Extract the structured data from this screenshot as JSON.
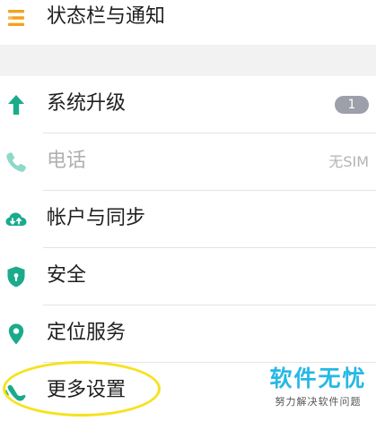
{
  "top_item": {
    "label": "状态栏与通知",
    "icon": "menu-lines-icon"
  },
  "items": [
    {
      "label": "系统升级",
      "icon": "arrow-up-icon",
      "badge": "1"
    },
    {
      "label": "电话",
      "icon": "phone-icon",
      "status": "无SIM",
      "disabled": true
    },
    {
      "label": "帐户与同步",
      "icon": "cloud-sync-icon"
    },
    {
      "label": "安全",
      "icon": "shield-icon"
    },
    {
      "label": "定位服务",
      "icon": "location-pin-icon"
    },
    {
      "label": "更多设置",
      "icon": "more-settings-icon",
      "highlighted": true
    }
  ],
  "watermark": {
    "title": "软件无忧",
    "subtitle": "努力解决软件问题"
  },
  "colors": {
    "accent_green": "#1aab8c",
    "menu_orange": "#f3a21d",
    "badge_gray": "#9d9faa",
    "highlight_yellow": "#f6e21c",
    "watermark_blue": "#26b8e6"
  }
}
